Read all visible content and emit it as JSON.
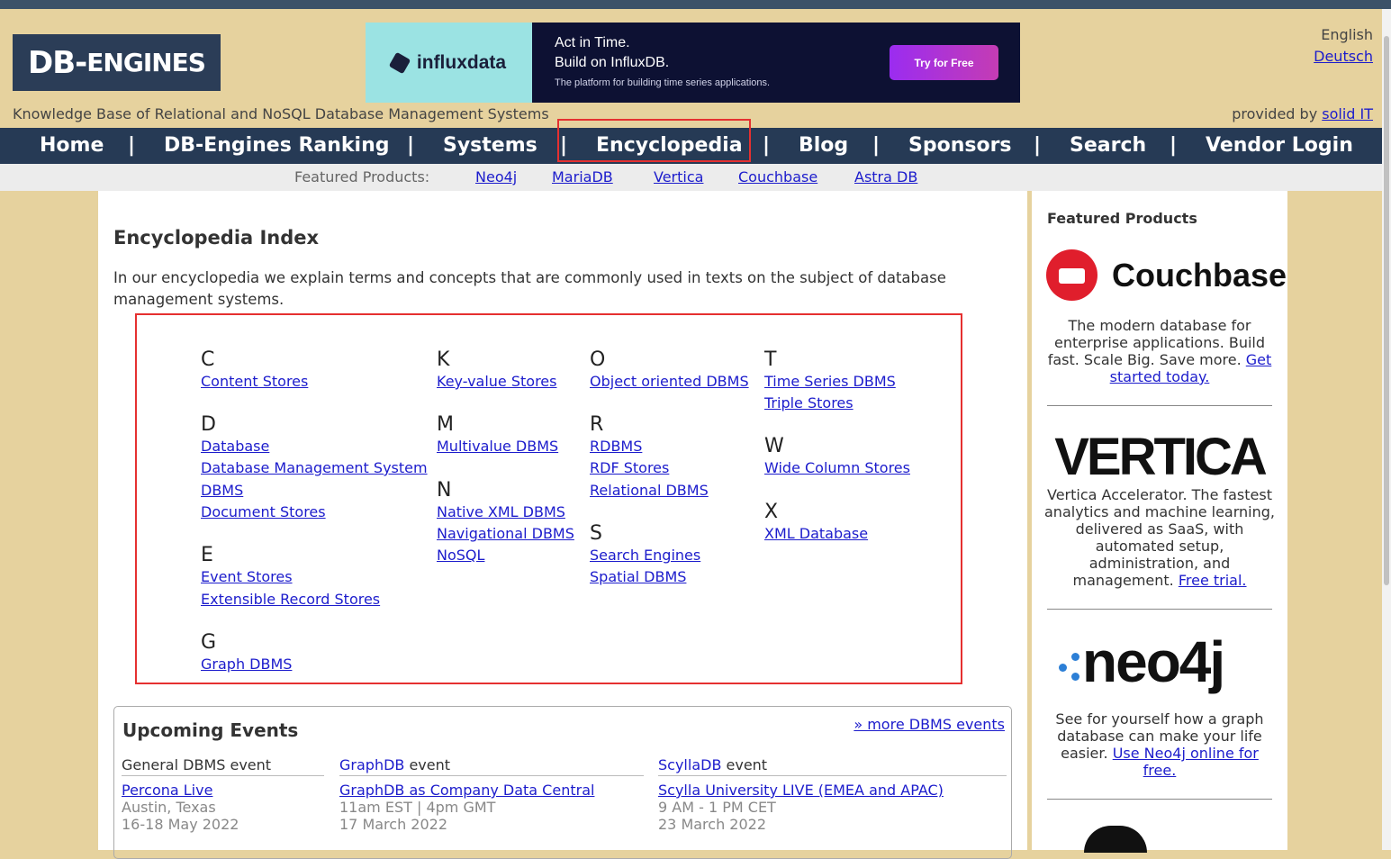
{
  "header": {
    "logo_text": "DB-",
    "logo_text_small": "ENGINES",
    "tagline": "Knowledge Base of Relational and NoSQL Database Management Systems",
    "provided_by_prefix": "provided by ",
    "provided_by_link": "solid IT",
    "languages": [
      "English",
      "Deutsch"
    ]
  },
  "ad": {
    "brand": "influxdata",
    "line1": "Act in Time.",
    "line2": "Build on InfluxDB.",
    "line3": "The platform for building time series applications.",
    "cta": "Try for Free"
  },
  "nav": {
    "items": [
      "Home",
      "DB-Engines Ranking",
      "Systems",
      "Encyclopedia",
      "Blog",
      "Sponsors",
      "Search",
      "Vendor Login"
    ],
    "separator": "|",
    "active": "Encyclopedia"
  },
  "featured_bar": {
    "label": "Featured Products:",
    "items": [
      "Neo4j",
      "MariaDB",
      "Vertica",
      "Couchbase",
      "Astra DB"
    ]
  },
  "encyclopedia": {
    "title": "Encyclopedia Index",
    "intro": "In our encyclopedia we explain terms and concepts that are commonly used in texts on the subject of database management systems.",
    "groups": {
      "C": {
        "letter": "C",
        "entries": [
          "Content Stores"
        ]
      },
      "D": {
        "letter": "D",
        "entries": [
          "Database",
          "Database Management System",
          "DBMS",
          "Document Stores"
        ]
      },
      "E": {
        "letter": "E",
        "entries": [
          "Event Stores",
          "Extensible Record Stores"
        ]
      },
      "G": {
        "letter": "G",
        "entries": [
          "Graph DBMS"
        ]
      },
      "K": {
        "letter": "K",
        "entries": [
          "Key-value Stores"
        ]
      },
      "M": {
        "letter": "M",
        "entries": [
          "Multivalue DBMS"
        ]
      },
      "N": {
        "letter": "N",
        "entries": [
          "Native XML DBMS",
          "Navigational DBMS",
          "NoSQL"
        ]
      },
      "O": {
        "letter": "O",
        "entries": [
          "Object oriented DBMS"
        ]
      },
      "R": {
        "letter": "R",
        "entries": [
          "RDBMS",
          "RDF Stores",
          "Relational DBMS"
        ]
      },
      "S": {
        "letter": "S",
        "entries": [
          "Search Engines",
          "Spatial DBMS"
        ]
      },
      "T": {
        "letter": "T",
        "entries": [
          "Time Series DBMS",
          "Triple Stores"
        ]
      },
      "W": {
        "letter": "W",
        "entries": [
          "Wide Column Stores"
        ]
      },
      "X": {
        "letter": "X",
        "entries": [
          "XML Database"
        ]
      }
    }
  },
  "events": {
    "title": "Upcoming Events",
    "more_link": "» more DBMS events",
    "columns": [
      {
        "category_link": "",
        "category_text": "General DBMS event",
        "name": "Percona Live",
        "line1": "Austin, Texas",
        "line2": "16-18 May 2022"
      },
      {
        "category_link": "GraphDB",
        "category_text": " event",
        "name": "GraphDB as Company Data Central",
        "line1": "11am EST | 4pm GMT",
        "line2": "17 March 2022"
      },
      {
        "category_link": "ScyllaDB",
        "category_text": " event",
        "name": "Scylla University LIVE (EMEA and APAC)",
        "line1": "9 AM - 1 PM CET",
        "line2": "23 March 2022"
      }
    ]
  },
  "sidebar": {
    "title": "Featured Products",
    "couchbase": {
      "name": "Couchbase",
      "text": "The modern database for enterprise applications. Build fast. Scale Big. Save more. ",
      "link": "Get started today."
    },
    "vertica": {
      "name": "VERTICA",
      "text": "Vertica Accelerator. The fastest analytics and machine learning, delivered as SaaS, with automated setup, administration, and management. ",
      "link": "Free trial."
    },
    "neo4j": {
      "name": "neo4j",
      "text": "See for yourself how a graph database can make your life easier. ",
      "link": "Use Neo4j online for free."
    }
  },
  "colors": {
    "nav_bg": "#263a55",
    "page_bg": "#e6d29e",
    "link": "#1c1ccc",
    "highlight": "#e53030"
  }
}
